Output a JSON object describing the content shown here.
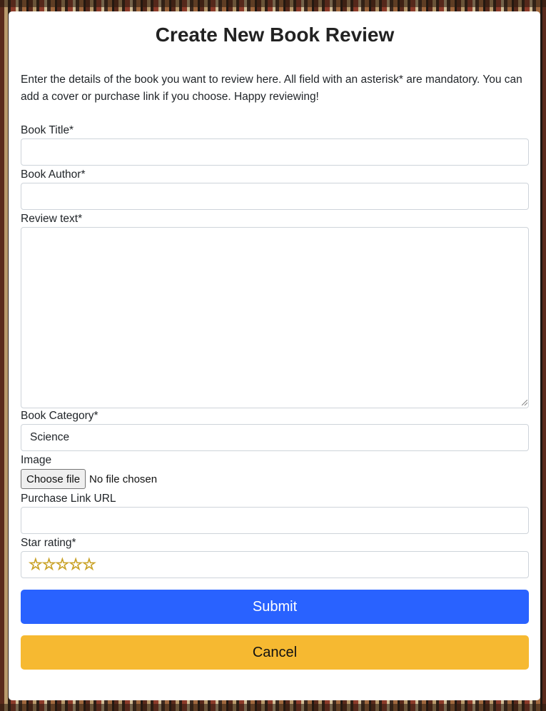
{
  "page": {
    "title": "Create New Book Review",
    "intro": "Enter the details of the book you want to review here. All field with an asterisk* are mandatory. You can add a cover or purchase link if you choose. Happy reviewing!"
  },
  "form": {
    "title_label": "Book Title*",
    "title_value": "",
    "author_label": "Book Author*",
    "author_value": "",
    "review_label": "Review text*",
    "review_value": "",
    "category_label": "Book Category*",
    "category_selected": "Science",
    "image_label": "Image",
    "image_button": "Choose file",
    "image_status": "No file chosen",
    "purchase_label": "Purchase Link URL",
    "purchase_value": "",
    "rating_label": "Star rating*",
    "rating_stars": [
      "☆",
      "☆",
      "☆",
      "☆",
      "☆"
    ],
    "rating_value": 0,
    "submit_label": "Submit",
    "cancel_label": "Cancel"
  },
  "colors": {
    "submit": "#2962ff",
    "cancel": "#f6b931",
    "star_fill": "#f6e58d"
  }
}
